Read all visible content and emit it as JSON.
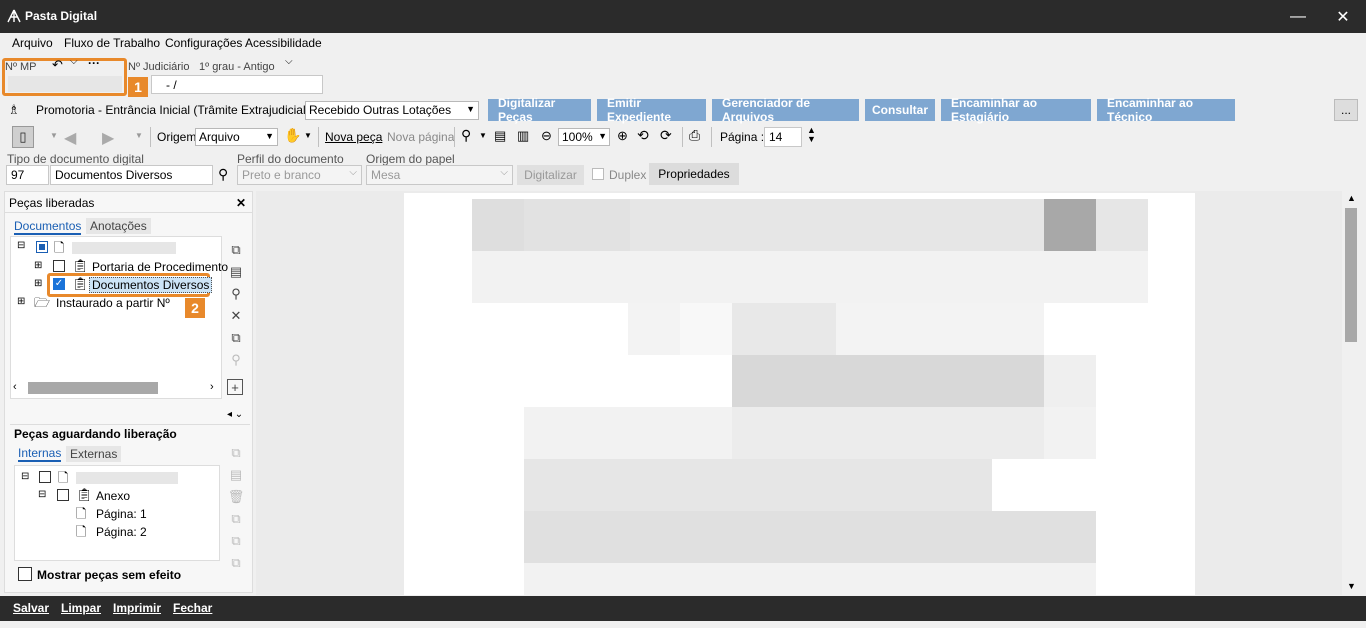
{
  "window": {
    "title": "Pasta Digital",
    "minimize": "—",
    "close": "✕"
  },
  "menu": [
    "Arquivo",
    "Fluxo de Trabalho",
    "Configurações",
    "Acessibilidade"
  ],
  "header": {
    "nmp_label": "Nº MP",
    "judiciario_label": "Nº Judiciário",
    "grau_label": "1º grau - Antigo",
    "judiciario_value": "- /",
    "badge1": "1",
    "promotoria": "Promotoria - Entrância Inicial (Trâmite Extrajudicial) - Fila",
    "fila": "Recebido Outras Lotações"
  },
  "actions": [
    "Digitalizar Peças",
    "Emitir Expediente",
    "Gerenciador de Arquivos",
    "Consultar",
    "Encaminhar ao Estagiário",
    "Encaminhar ao Técnico"
  ],
  "more_button": "...",
  "toolbar": {
    "origem_label": "Origem",
    "origem_value": "Arquivo",
    "nova_peca": "Nova peça",
    "nova_pagina": "Nova página",
    "zoom": "100%",
    "pagina_label": "Página :",
    "pagina_value": "14"
  },
  "docfields": {
    "tipo_label": "Tipo de documento digital",
    "tipo_code": "97",
    "tipo_value": "Documentos Diversos",
    "perfil_label": "Perfil do documento",
    "perfil_value": "Preto e branco",
    "origem_papel_label": "Origem do papel",
    "origem_papel_value": "Mesa",
    "digitalizar": "Digitalizar",
    "duplex": "Duplex",
    "propriedades": "Propriedades"
  },
  "left_panel": {
    "title": "Peças liberadas",
    "close": "✕",
    "tabs": [
      "Documentos",
      "Anotações"
    ],
    "tree": [
      "Portaria de Procedimento",
      "Documentos Diversos",
      "Instaurado a partir Nº"
    ],
    "badge2": "2",
    "waiting_title": "Peças aguardando liberação",
    "waiting_tabs": [
      "Internas",
      "Externas"
    ],
    "waiting_tree": [
      "Anexo",
      "Página: 1",
      "Página: 2"
    ],
    "mostrar": "Mostrar peças sem efeito"
  },
  "bottom": [
    "Salvar",
    "Limpar",
    "Imprimir",
    "Fechar"
  ],
  "colors": {
    "accent_button": "#7fa7d1",
    "highlight": "#e8892b",
    "titlebar": "#2b2b2b",
    "selection": "#cce4f7"
  }
}
